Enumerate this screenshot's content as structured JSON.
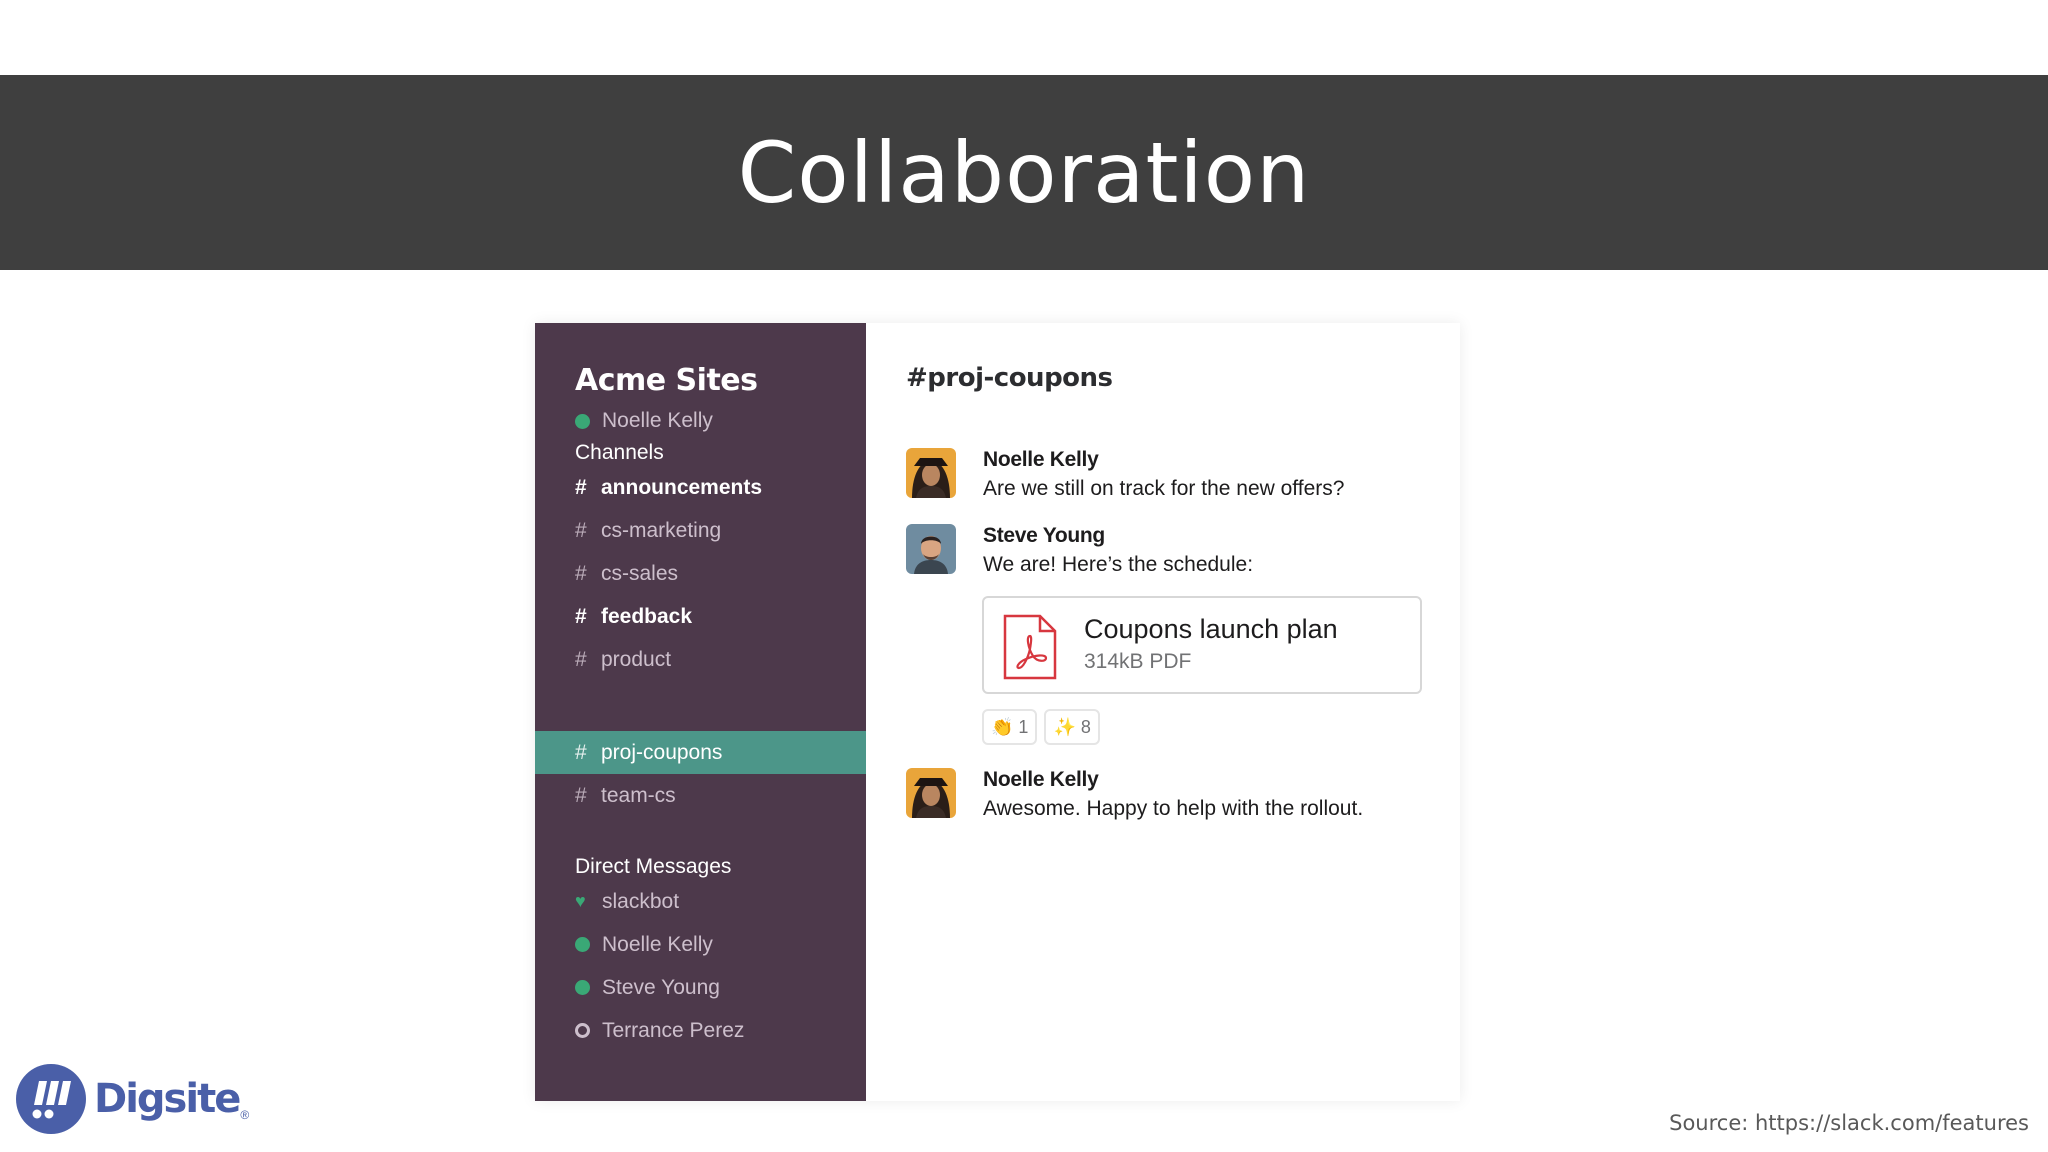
{
  "slide": {
    "title": "Collaboration",
    "source": "Source: https://slack.com/features"
  },
  "logo": {
    "name": "Digsite",
    "registered": "®"
  },
  "colors": {
    "banner": "#3f3f3f",
    "sidebar": "#4d394b",
    "active_channel": "#4c9689",
    "presence_online": "#3aa876",
    "logo_blue": "#4a5fa8"
  },
  "sidebar": {
    "workspace": "Acme Sites",
    "current_user": "Noelle Kelly",
    "channels_label": "Channels",
    "channels": [
      {
        "name": "announcements",
        "unread": true,
        "active": false
      },
      {
        "name": "cs-marketing",
        "unread": false,
        "active": false
      },
      {
        "name": "cs-sales",
        "unread": false,
        "active": false
      },
      {
        "name": "feedback",
        "unread": true,
        "active": false
      },
      {
        "name": "product",
        "unread": false,
        "active": false
      },
      {
        "name": "proj-coupons",
        "unread": false,
        "active": true
      },
      {
        "name": "team-cs",
        "unread": false,
        "active": false
      }
    ],
    "dm_label": "Direct Messages",
    "dms": [
      {
        "name": "slackbot",
        "status": "heart-icon"
      },
      {
        "name": "Noelle Kelly",
        "status": "online"
      },
      {
        "name": "Steve Young",
        "status": "online"
      },
      {
        "name": "Terrance Perez",
        "status": "away"
      }
    ]
  },
  "channel": {
    "title": "#proj-coupons",
    "messages": [
      {
        "author": "Noelle Kelly",
        "text": "Are we still on track for the new offers?"
      },
      {
        "author": "Steve Young",
        "text": "We are! Here’s the schedule:"
      },
      {
        "author": "Noelle Kelly",
        "text": "Awesome. Happy to help with the rollout."
      }
    ],
    "attachment": {
      "name": "Coupons launch plan",
      "meta": "314kB PDF",
      "icon": "pdf-icon"
    },
    "reactions": [
      {
        "emoji": "👏",
        "icon": "clap-emoji",
        "count": "1"
      },
      {
        "emoji": "✨",
        "icon": "sparkles-emoji",
        "count": "8"
      }
    ]
  }
}
